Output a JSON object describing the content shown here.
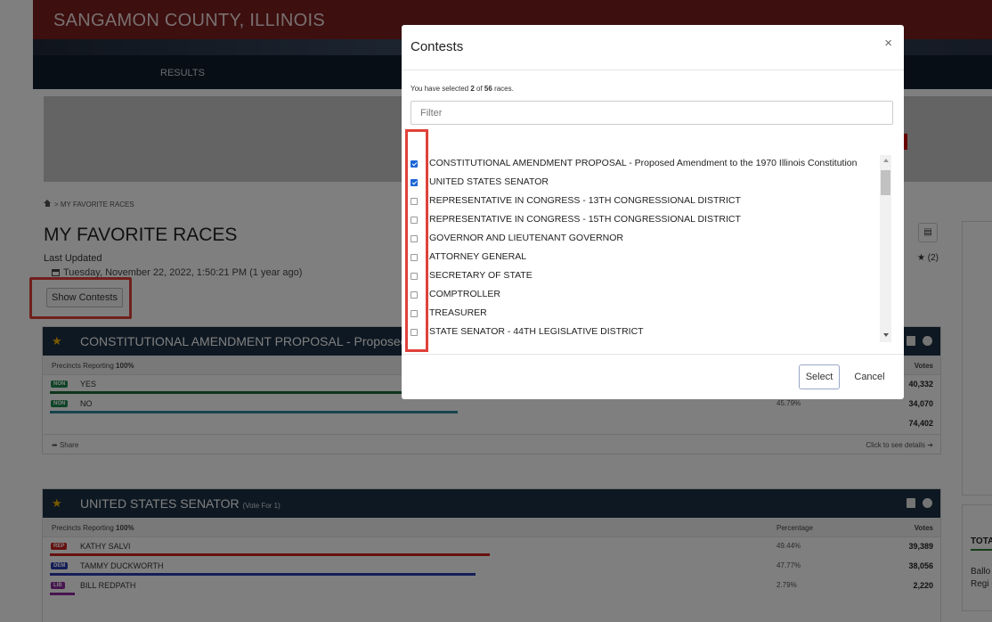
{
  "header": {
    "county": "SANGAMON COUNTY, ILLINOIS",
    "nav_results": "RESULTS"
  },
  "breadcrumb": {
    "current": "> MY FAVORITE RACES"
  },
  "page": {
    "title": "MY FAVORITE RACES",
    "last_updated_label": "Last Updated",
    "last_updated_value": "Tuesday, November 22, 2022, 1:50:21 PM  (1 year ago)",
    "show_contests": "Show Contests",
    "star_count": "★ (2)"
  },
  "side": {
    "tota": "TOTA",
    "ballo": "Ballo",
    "regi": "Regi"
  },
  "cards": [
    {
      "title": "CONSTITUTIONAL AMENDMENT PROPOSAL - Proposed Am",
      "vote_for": "",
      "precincts": "Precincts Reporting",
      "precincts_pct": "100%",
      "percentage_header": "",
      "votes_header": "Votes",
      "rows": [
        {
          "badge": "NON",
          "badge_color": "#1e8a4f",
          "name": "YES",
          "pct": "",
          "votes": "40,332",
          "fill": 0.54,
          "bar_color": "#1e6b3a"
        },
        {
          "badge": "NON",
          "badge_color": "#1e8a4f",
          "name": "NO",
          "pct": "45.79%",
          "votes": "34,070",
          "fill": 0.458,
          "bar_color": "#2e8b9a"
        }
      ],
      "total": "74,402",
      "share": "Share",
      "details": "Click to see details"
    },
    {
      "title": "UNITED STATES SENATOR",
      "vote_for": "(Vote For 1)",
      "precincts": "Precincts Reporting",
      "precincts_pct": "100%",
      "percentage_header": "Percentage",
      "votes_header": "Votes",
      "rows": [
        {
          "badge": "REP",
          "badge_color": "#cc2222",
          "name": "KATHY SALVI",
          "pct": "49.44%",
          "votes": "39,389",
          "fill": 0.494,
          "bar_color": "#cc2222"
        },
        {
          "badge": "DEM",
          "badge_color": "#2a3db0",
          "name": "TAMMY DUCKWORTH",
          "pct": "47.77%",
          "votes": "38,056",
          "fill": 0.478,
          "bar_color": "#2a3db0"
        },
        {
          "badge": "LIB",
          "badge_color": "#8e2a9e",
          "name": "BILL REDPATH",
          "pct": "2.79%",
          "votes": "2,220",
          "fill": 0.028,
          "bar_color": "#8e2a9e"
        }
      ]
    }
  ],
  "modal": {
    "title": "Contests",
    "close": "×",
    "selected_prefix": "You have selected",
    "selected_count": "2",
    "selected_of": "of",
    "total_count": "56",
    "selected_suffix": "races.",
    "filter_placeholder": "Filter",
    "contests": [
      {
        "label": "CONSTITUTIONAL AMENDMENT PROPOSAL - Proposed Amendment to the 1970 Illinois Constitution",
        "checked": true
      },
      {
        "label": "UNITED STATES SENATOR",
        "checked": true
      },
      {
        "label": "REPRESENTATIVE IN CONGRESS - 13TH CONGRESSIONAL DISTRICT",
        "checked": false
      },
      {
        "label": "REPRESENTATIVE IN CONGRESS - 15TH CONGRESSIONAL DISTRICT",
        "checked": false
      },
      {
        "label": "GOVERNOR AND LIEUTENANT GOVERNOR",
        "checked": false
      },
      {
        "label": "ATTORNEY GENERAL",
        "checked": false
      },
      {
        "label": "SECRETARY OF STATE",
        "checked": false
      },
      {
        "label": "COMPTROLLER",
        "checked": false
      },
      {
        "label": "TREASURER",
        "checked": false
      },
      {
        "label": "STATE SENATOR - 44TH LEGISLATIVE DISTRICT",
        "checked": false
      }
    ],
    "select_label": "Select",
    "cancel_label": "Cancel"
  }
}
